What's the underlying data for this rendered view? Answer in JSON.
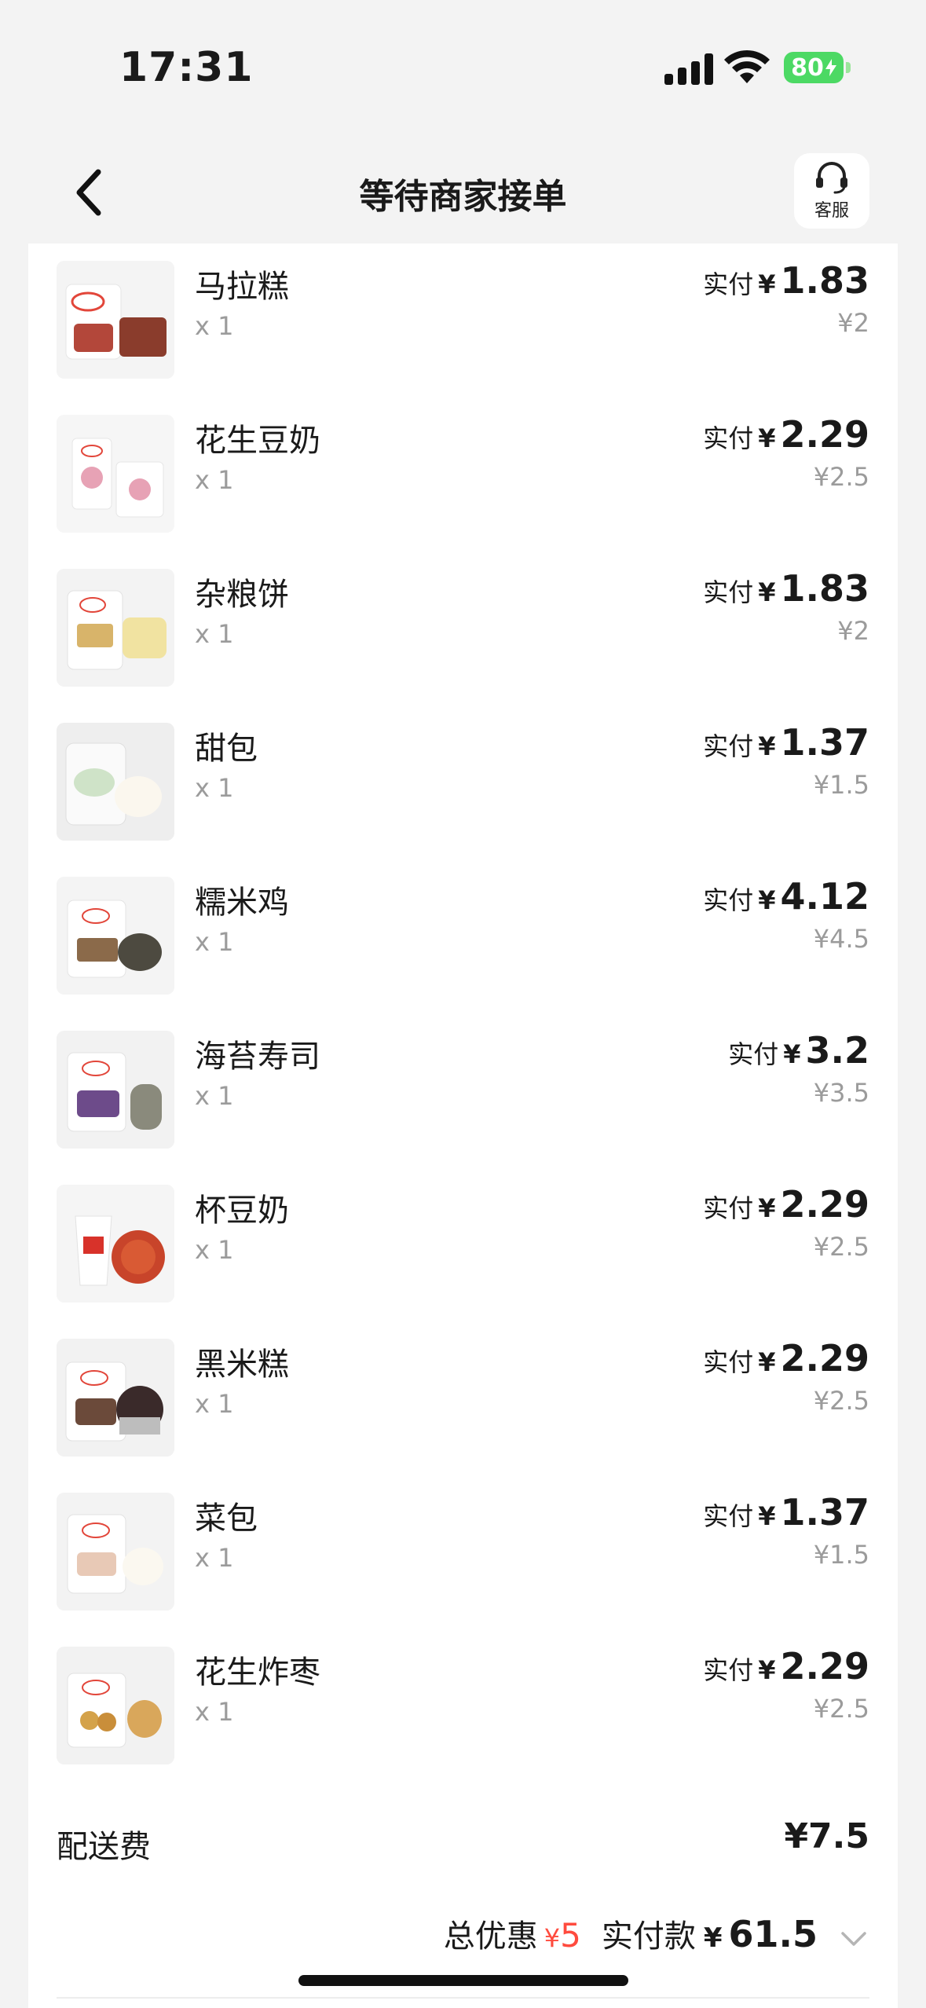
{
  "status_bar": {
    "time": "17:31",
    "battery": "80"
  },
  "nav": {
    "title": "等待商家接单",
    "service_label": "客服"
  },
  "paid_label": "实付",
  "currency": "¥",
  "items": [
    {
      "name": "马拉糕",
      "qty": "x 1",
      "paid": "1.83",
      "original": "¥2"
    },
    {
      "name": "花生豆奶",
      "qty": "x 1",
      "paid": "2.29",
      "original": "¥2.5"
    },
    {
      "name": "杂粮饼",
      "qty": "x 1",
      "paid": "1.83",
      "original": "¥2"
    },
    {
      "name": "甜包",
      "qty": "x 1",
      "paid": "1.37",
      "original": "¥1.5"
    },
    {
      "name": "糯米鸡",
      "qty": "x 1",
      "paid": "4.12",
      "original": "¥4.5"
    },
    {
      "name": "海苔寿司",
      "qty": "x 1",
      "paid": "3.2",
      "original": "¥3.5"
    },
    {
      "name": "杯豆奶",
      "qty": "x 1",
      "paid": "2.29",
      "original": "¥2.5"
    },
    {
      "name": "黑米糕",
      "qty": "x 1",
      "paid": "2.29",
      "original": "¥2.5"
    },
    {
      "name": "菜包",
      "qty": "x 1",
      "paid": "1.37",
      "original": "¥1.5"
    },
    {
      "name": "花生炸枣",
      "qty": "x 1",
      "paid": "2.29",
      "original": "¥2.5"
    }
  ],
  "delivery": {
    "label": "配送费",
    "fee": "¥7.5"
  },
  "summary": {
    "discount_label": "总优惠",
    "discount_currency": "¥",
    "discount_amount": "5",
    "total_label": "实付款",
    "total_currency": "¥",
    "total_amount": "61.5"
  },
  "colors": {
    "accent_discount": "#ff4b3e",
    "battery": "#4cd964",
    "muted": "#9b9b9b"
  }
}
